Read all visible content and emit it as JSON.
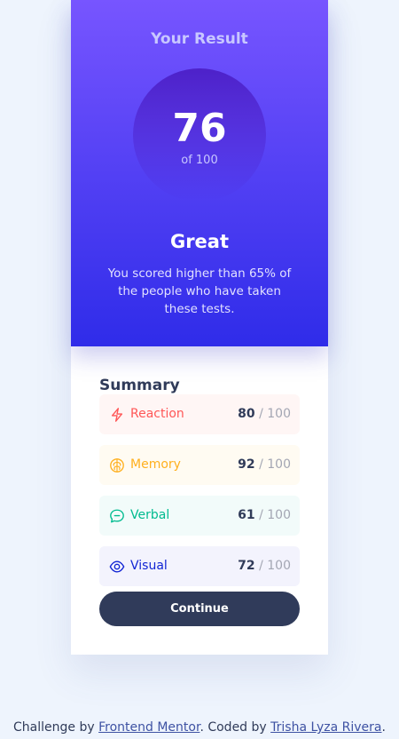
{
  "result": {
    "heading": "Your Result",
    "score": "76",
    "score_max": "of 100",
    "rating": "Great",
    "description": "You scored higher than 65% of the people who have taken these tests."
  },
  "summary": {
    "title": "Summary",
    "items": [
      {
        "label": "Reaction",
        "value": "80",
        "max": " / 100",
        "icon": "lightning-icon",
        "color": "#ff5757"
      },
      {
        "label": "Memory",
        "value": "92",
        "max": " / 100",
        "icon": "brain-icon",
        "color": "#ffb01f"
      },
      {
        "label": "Verbal",
        "value": "61",
        "max": " / 100",
        "icon": "speech-bubble-icon",
        "color": "#00bb8f"
      },
      {
        "label": "Visual",
        "value": "72",
        "max": " / 100",
        "icon": "eye-icon",
        "color": "#1125d4"
      }
    ],
    "continue_label": "Continue"
  },
  "attribution": {
    "prefix": "Challenge by ",
    "mentor_link": "Frontend Mentor",
    "middle": ". Coded by ",
    "author_link": "Trisha Lyza Rivera",
    "suffix": "."
  },
  "colors": {
    "gradient_top": "#7755ff",
    "gradient_bottom": "#2f2ce9",
    "button": "#303b5a"
  }
}
